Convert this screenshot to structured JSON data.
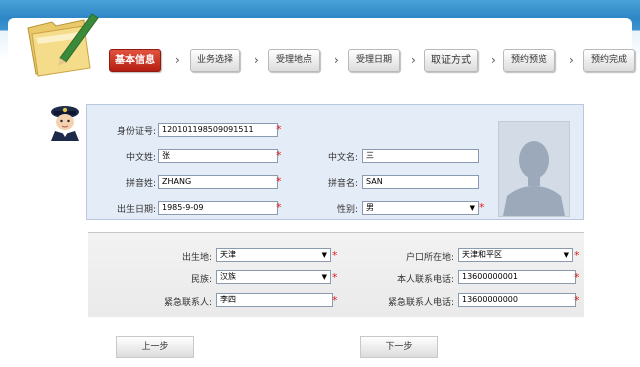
{
  "steps": [
    {
      "label": "基本信息",
      "active": true
    },
    {
      "label": "业务选择"
    },
    {
      "label": "受理地点"
    },
    {
      "label": "受理日期"
    },
    {
      "label": "取证方式"
    },
    {
      "label": "预约预览"
    },
    {
      "label": "预约完成"
    }
  ],
  "arrow_glyph": "›",
  "required_mark": "*",
  "basic": {
    "id_label": "身份证号:",
    "id_value": "120101198509091511",
    "cn_surname_label": "中文姓:",
    "cn_surname_value": "张",
    "cn_name_label": "中文名:",
    "cn_name_value": "三",
    "py_surname_label": "拼音姓:",
    "py_surname_value": "ZHANG",
    "py_name_label": "拼音名:",
    "py_name_value": "SAN",
    "birth_label": "出生日期:",
    "birth_value": "1985-9-09",
    "gender_label": "性别:",
    "gender_value": "男"
  },
  "extra": {
    "birthplace_label": "出生地:",
    "birthplace_value": "天津",
    "hukou_label": "户口所在地:",
    "hukou_value": "天津和平区",
    "ethnicity_label": "民族:",
    "ethnicity_value": "汉族",
    "phone_label": "本人联系电话:",
    "phone_value": "13600000001",
    "emergency_label": "紧急联系人:",
    "emergency_value": "李四",
    "emergency_phone_label": "紧急联系人电话:",
    "emergency_phone_value": "13600000000"
  },
  "buttons": {
    "prev": "上一步",
    "next": "下一步"
  },
  "colors": {
    "accent": "#c0281a",
    "header": "#2f86c6",
    "section_bg": "#e4ecf7"
  },
  "icons": {
    "folder": "folder-pen-icon",
    "officer": "police-officer-icon",
    "photo": "person-silhouette-icon"
  }
}
